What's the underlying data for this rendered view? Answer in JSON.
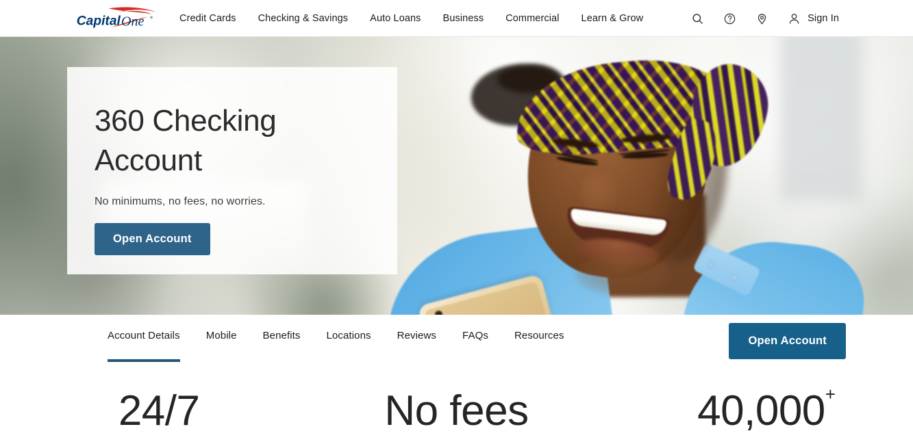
{
  "header": {
    "logo_alt": "Capital One",
    "logo_text_bold": "Capital",
    "logo_text_italic": "One",
    "nav_items": [
      {
        "label": "Credit Cards",
        "name": "nav-credit-cards"
      },
      {
        "label": "Checking & Savings",
        "name": "nav-checking-savings"
      },
      {
        "label": "Auto Loans",
        "name": "nav-auto-loans"
      },
      {
        "label": "Business",
        "name": "nav-business"
      },
      {
        "label": "Commercial",
        "name": "nav-commercial"
      },
      {
        "label": "Learn & Grow",
        "name": "nav-learn-grow"
      }
    ],
    "icons": [
      {
        "name": "search-icon",
        "label": "Search"
      },
      {
        "name": "help-icon",
        "label": "Help"
      },
      {
        "name": "location-pin-icon",
        "label": "Locations"
      }
    ],
    "sign_in_label": "Sign In"
  },
  "hero": {
    "title": "360 Checking Account",
    "subtitle": "No minimums, no fees, no worries.",
    "cta_label": "Open Account",
    "cta_color": "#2e6489",
    "image_description": "Smiling woman wearing a yellow and purple patterned head wrap and a light blue top, looking at a gold smartphone, with a blurred city background"
  },
  "tabbar": {
    "tabs": [
      {
        "label": "Account Details",
        "active": true
      },
      {
        "label": "Mobile",
        "active": false
      },
      {
        "label": "Benefits",
        "active": false
      },
      {
        "label": "Locations",
        "active": false
      },
      {
        "label": "Reviews",
        "active": false
      },
      {
        "label": "FAQs",
        "active": false
      },
      {
        "label": "Resources",
        "active": false
      }
    ],
    "cta_label": "Open Account",
    "cta_color": "#17608a",
    "active_underline_color": "#22577a"
  },
  "stats": [
    {
      "value": "24/7",
      "suffix": ""
    },
    {
      "value": "No fees",
      "suffix": ""
    },
    {
      "value": "40,000",
      "suffix": "+"
    }
  ],
  "colors": {
    "brand_navy": "#003a70",
    "brand_red": "#d03027",
    "text_primary": "#1b1b1b",
    "header_border": "#e3e3e3"
  }
}
